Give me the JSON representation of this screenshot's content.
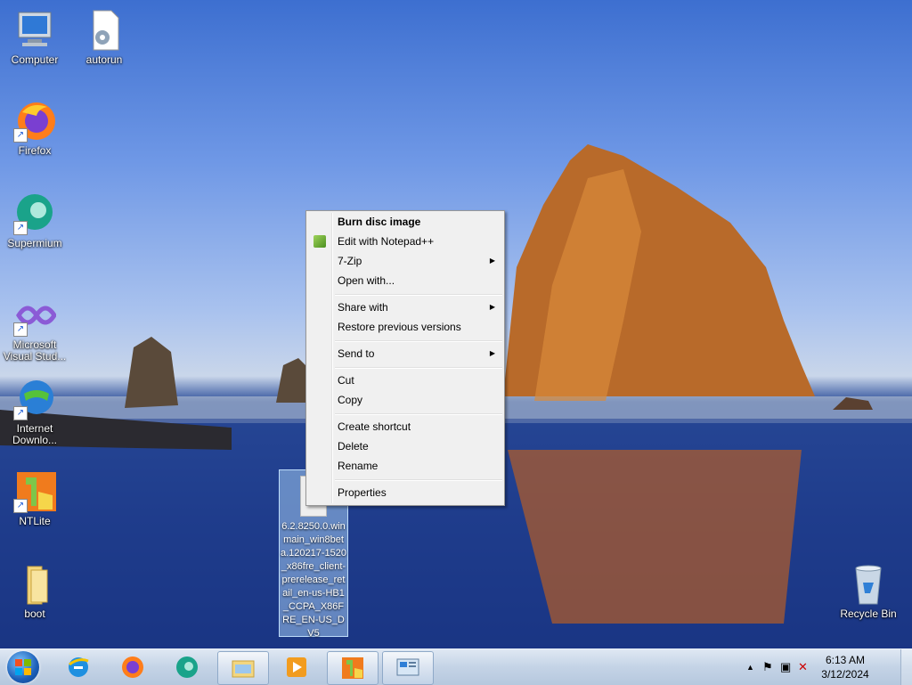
{
  "desktop": {
    "icons": [
      {
        "label": "Computer",
        "icon": "computer-icon"
      },
      {
        "label": "autorun",
        "icon": "settings-file-icon"
      },
      {
        "label": "Firefox",
        "icon": "firefox-icon"
      },
      {
        "label": "Supermium",
        "icon": "supermium-icon"
      },
      {
        "label": "Microsoft Visual Stud...",
        "icon": "visual-studio-icon"
      },
      {
        "label": "Internet Downlo...",
        "icon": "internet-download-manager-icon"
      },
      {
        "label": "NTLite",
        "icon": "ntlite-icon"
      },
      {
        "label": "boot",
        "icon": "folder-icon"
      },
      {
        "label": "Recycle Bin",
        "icon": "recycle-bin-icon"
      }
    ],
    "selected_file": {
      "label": "6.2.8250.0.winmain_win8beta.120217-1520_x86fre_client-prerelease_retail_en-us-HB1_CCPA_X86FRE_EN-US_DV5"
    }
  },
  "context_menu": {
    "items": [
      {
        "label": "Burn disc image",
        "bold": true
      },
      {
        "label": "Edit with Notepad++",
        "icon": "notepad-plus-plus-icon"
      },
      {
        "label": "7-Zip",
        "submenu": true
      },
      {
        "label": "Open with..."
      },
      {
        "label": "Share with",
        "submenu": true
      },
      {
        "label": "Restore previous versions"
      },
      {
        "label": "Send to",
        "submenu": true
      },
      {
        "label": "Cut"
      },
      {
        "label": "Copy"
      },
      {
        "label": "Create shortcut"
      },
      {
        "label": "Delete"
      },
      {
        "label": "Rename"
      },
      {
        "label": "Properties"
      }
    ],
    "submenu_arrow": "▶"
  },
  "taskbar": {
    "start_icon": "windows-start-icon",
    "pinned": [
      "internet-explorer-icon",
      "firefox-icon",
      "supermium-icon",
      "file-explorer-icon",
      "media-player-icon",
      "ntlite-icon",
      "control-panel-icon"
    ],
    "clock": {
      "time": "6:13 AM",
      "date": "3/12/2024"
    },
    "tray": [
      "show-hidden-icons-icon",
      "action-center-flag-icon",
      "network-icon",
      "volume-muted-icon"
    ]
  }
}
